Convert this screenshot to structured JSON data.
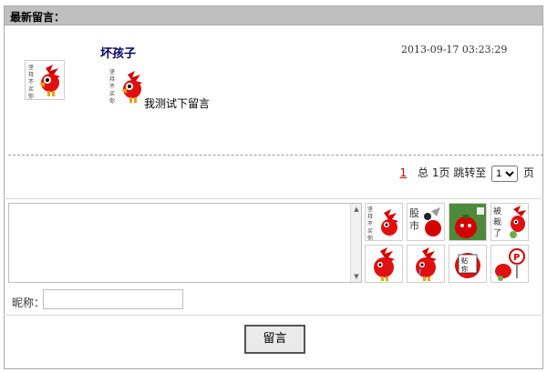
{
  "panel": {
    "title": "最新留言："
  },
  "message": {
    "author": "坏孩子",
    "timestamp": "2013-09-17 03:23:29",
    "text": "我测试下留言",
    "avatar_icon": "red-bird-avatar-icon",
    "avatar_caption": "坚持不买你"
  },
  "pagination": {
    "current_page": "1",
    "total_label": "总",
    "total_pages": "1页",
    "jump_label": "跳转至",
    "jump_value": "1",
    "page_suffix": "页"
  },
  "form": {
    "nickname_label": "昵称：",
    "nickname_value": "",
    "submit_label": "留言"
  },
  "emoticons": [
    {
      "name": "emoticon-bird-jianchi",
      "caption": "坚持不买你"
    },
    {
      "name": "emoticon-stock-market",
      "caption": "股市"
    },
    {
      "name": "emoticon-red-tomato-bomb",
      "caption": ""
    },
    {
      "name": "emoticon-bei-cai-le",
      "caption": "被裁了"
    },
    {
      "name": "emoticon-bird-sad",
      "caption": ""
    },
    {
      "name": "emoticon-bird-crying",
      "caption": ""
    },
    {
      "name": "emoticon-tie-ni",
      "caption": "贴你"
    },
    {
      "name": "emoticon-bird-parking",
      "caption": ""
    }
  ],
  "colors": {
    "title_bg": "#bfbfbf",
    "author_color": "#000066",
    "current_page_color": "#cc0000",
    "bird_red": "#d40000"
  }
}
